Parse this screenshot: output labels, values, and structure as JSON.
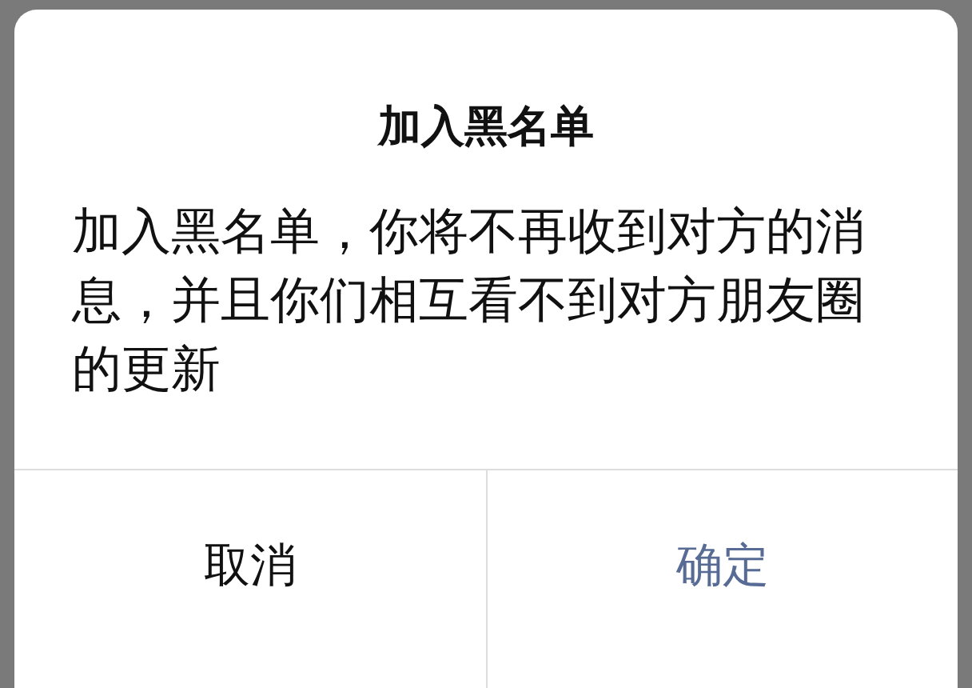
{
  "dialog": {
    "title": "加入黑名单",
    "message": "加入黑名单，你将不再收到对方的消息，并且你们相互看不到对方朋友圈的更新",
    "buttons": [
      {
        "label": "取消",
        "kind": "cancel"
      },
      {
        "label": "确定",
        "kind": "confirm"
      }
    ]
  }
}
